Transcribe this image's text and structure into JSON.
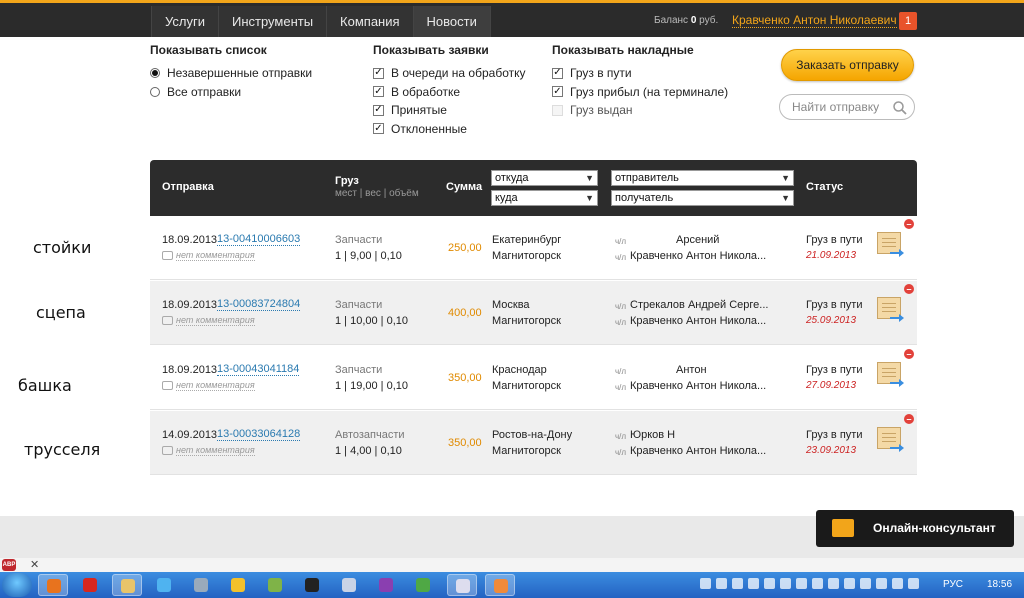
{
  "nav": {
    "tabs": [
      "Услуги",
      "Инструменты",
      "Компания",
      "Новости"
    ]
  },
  "account": {
    "balance_label": "Баланс",
    "balance_value": "0",
    "balance_currency": "руб.",
    "user_name": "Кравченко Антон Николаевич",
    "notifications": "1"
  },
  "filters": {
    "list": {
      "title": "Показывать список",
      "options": [
        "Незавершенные отправки",
        "Все отправки"
      ]
    },
    "requests": {
      "title": "Показывать заявки",
      "options": [
        "В очереди на обработку",
        "В обработке",
        "Принятые",
        "Отклоненные"
      ]
    },
    "waybills": {
      "title": "Показывать накладные",
      "options": [
        "Груз в пути",
        "Груз прибыл (на терминале)",
        "Груз выдан"
      ]
    }
  },
  "actions": {
    "order_label": "Заказать отправку",
    "search_placeholder": "Найти отправку"
  },
  "table": {
    "headers": {
      "shipment": "Отправка",
      "cargo": "Груз",
      "cargo_sub": "мест | вес | объём",
      "sum": "Сумма",
      "status": "Статус"
    },
    "selects": {
      "from": "откуда",
      "to": "куда",
      "sender": "отправитель",
      "receiver": "получатель"
    },
    "rows": [
      {
        "date": "18.09.2013",
        "number": "13-00410006603",
        "comment": "нет комментария",
        "cargo": "Запчасти",
        "cargo_details": "1 | 9,00 | 0,10",
        "sum": "250,00",
        "from": "Екатеринбург",
        "to": "Магнитогорск",
        "sender_prefix": "ч/л",
        "sender": "Арсений",
        "receiver_prefix": "ч/л",
        "receiver": "Кравченко Антон Никола...",
        "status": "Груз в пути",
        "status_date": "21.09.2013"
      },
      {
        "date": "18.09.2013",
        "number": "13-00083724804",
        "comment": "нет комментария",
        "cargo": "Запчасти",
        "cargo_details": "1 | 10,00 | 0,10",
        "sum": "400,00",
        "from": "Москва",
        "to": "Магнитогорск",
        "sender_prefix": "ч/л",
        "sender": "Стрекалов Андрей Серге...",
        "receiver_prefix": "ч/л",
        "receiver": "Кравченко Антон Никола...",
        "status": "Груз в пути",
        "status_date": "25.09.2013"
      },
      {
        "date": "18.09.2013",
        "number": "13-00043041184",
        "comment": "нет комментария",
        "cargo": "Запчасти",
        "cargo_details": "1 | 19,00 | 0,10",
        "sum": "350,00",
        "from": "Краснодар",
        "to": "Магнитогорск",
        "sender_prefix": "ч/л",
        "sender": "Антон",
        "receiver_prefix": "ч/л",
        "receiver": "Кравченко Антон Никола...",
        "status": "Груз в пути",
        "status_date": "27.09.2013"
      },
      {
        "date": "14.09.2013",
        "number": "13-00033064128",
        "comment": "нет комментария",
        "cargo": "Автозапчасти",
        "cargo_details": "1 | 4,00 | 0,10",
        "sum": "350,00",
        "from": "Ростов-на-Дону",
        "to": "Магнитогорск",
        "sender_prefix": "ч/л",
        "sender": "Юрков Н",
        "receiver_prefix": "ч/л",
        "receiver": "Кравченко Антон Никола...",
        "status": "Груз в пути",
        "status_date": "23.09.2013"
      }
    ]
  },
  "annotations": [
    "стойки",
    "сцепа",
    "башка",
    "трусселя"
  ],
  "consultant": {
    "label": "Онлайн-консультант"
  },
  "taskbar": {
    "language": "РУС",
    "time": "18:56"
  },
  "browser": {
    "adblock": "ABP",
    "close": "✕"
  },
  "colors": {
    "accent": "#f2a51a",
    "link": "#2a7ab0",
    "status_date": "#cc2222",
    "header_bg": "#2c2c2c"
  }
}
